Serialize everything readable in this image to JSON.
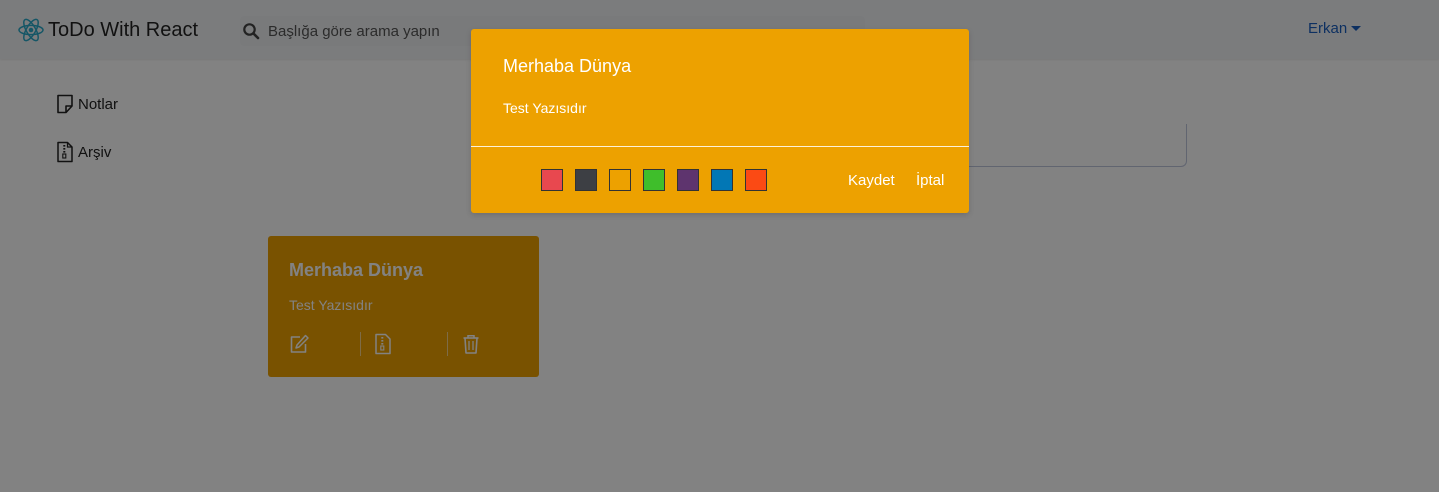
{
  "navbar": {
    "brand_title": "ToDo With React",
    "brand_logo_icon": "react-logo-icon",
    "search": {
      "icon": "search-icon",
      "placeholder": "Başlığa göre arama yapın",
      "value": ""
    },
    "user": {
      "label": "Erkan",
      "icon": "caret-down-icon"
    }
  },
  "sidebar": {
    "items": [
      {
        "label": "Notlar",
        "icon": "note-icon"
      },
      {
        "label": "Arşiv",
        "icon": "archive-file-icon"
      }
    ]
  },
  "note_card": {
    "title": "Merhaba Dünya",
    "body": "Test Yazısıdır",
    "actions": [
      {
        "icon": "edit-icon"
      },
      {
        "icon": "archive-file-icon"
      },
      {
        "icon": "trash-icon"
      }
    ],
    "color": "#eda100"
  },
  "modal": {
    "title": "Merhaba Dünya",
    "body": "Test Yazısıdır",
    "color_options": [
      "#e8484f",
      "#3d3f44",
      "#eda100",
      "#3fbe2b",
      "#5e346e",
      "#0277b5",
      "#fb4a14"
    ],
    "save_label": "Kaydet",
    "cancel_label": "İptal"
  },
  "colors": {
    "accent": "#eda100",
    "link": "#1a5fbf",
    "overlay": "rgba(0,0,0,0.49)"
  }
}
